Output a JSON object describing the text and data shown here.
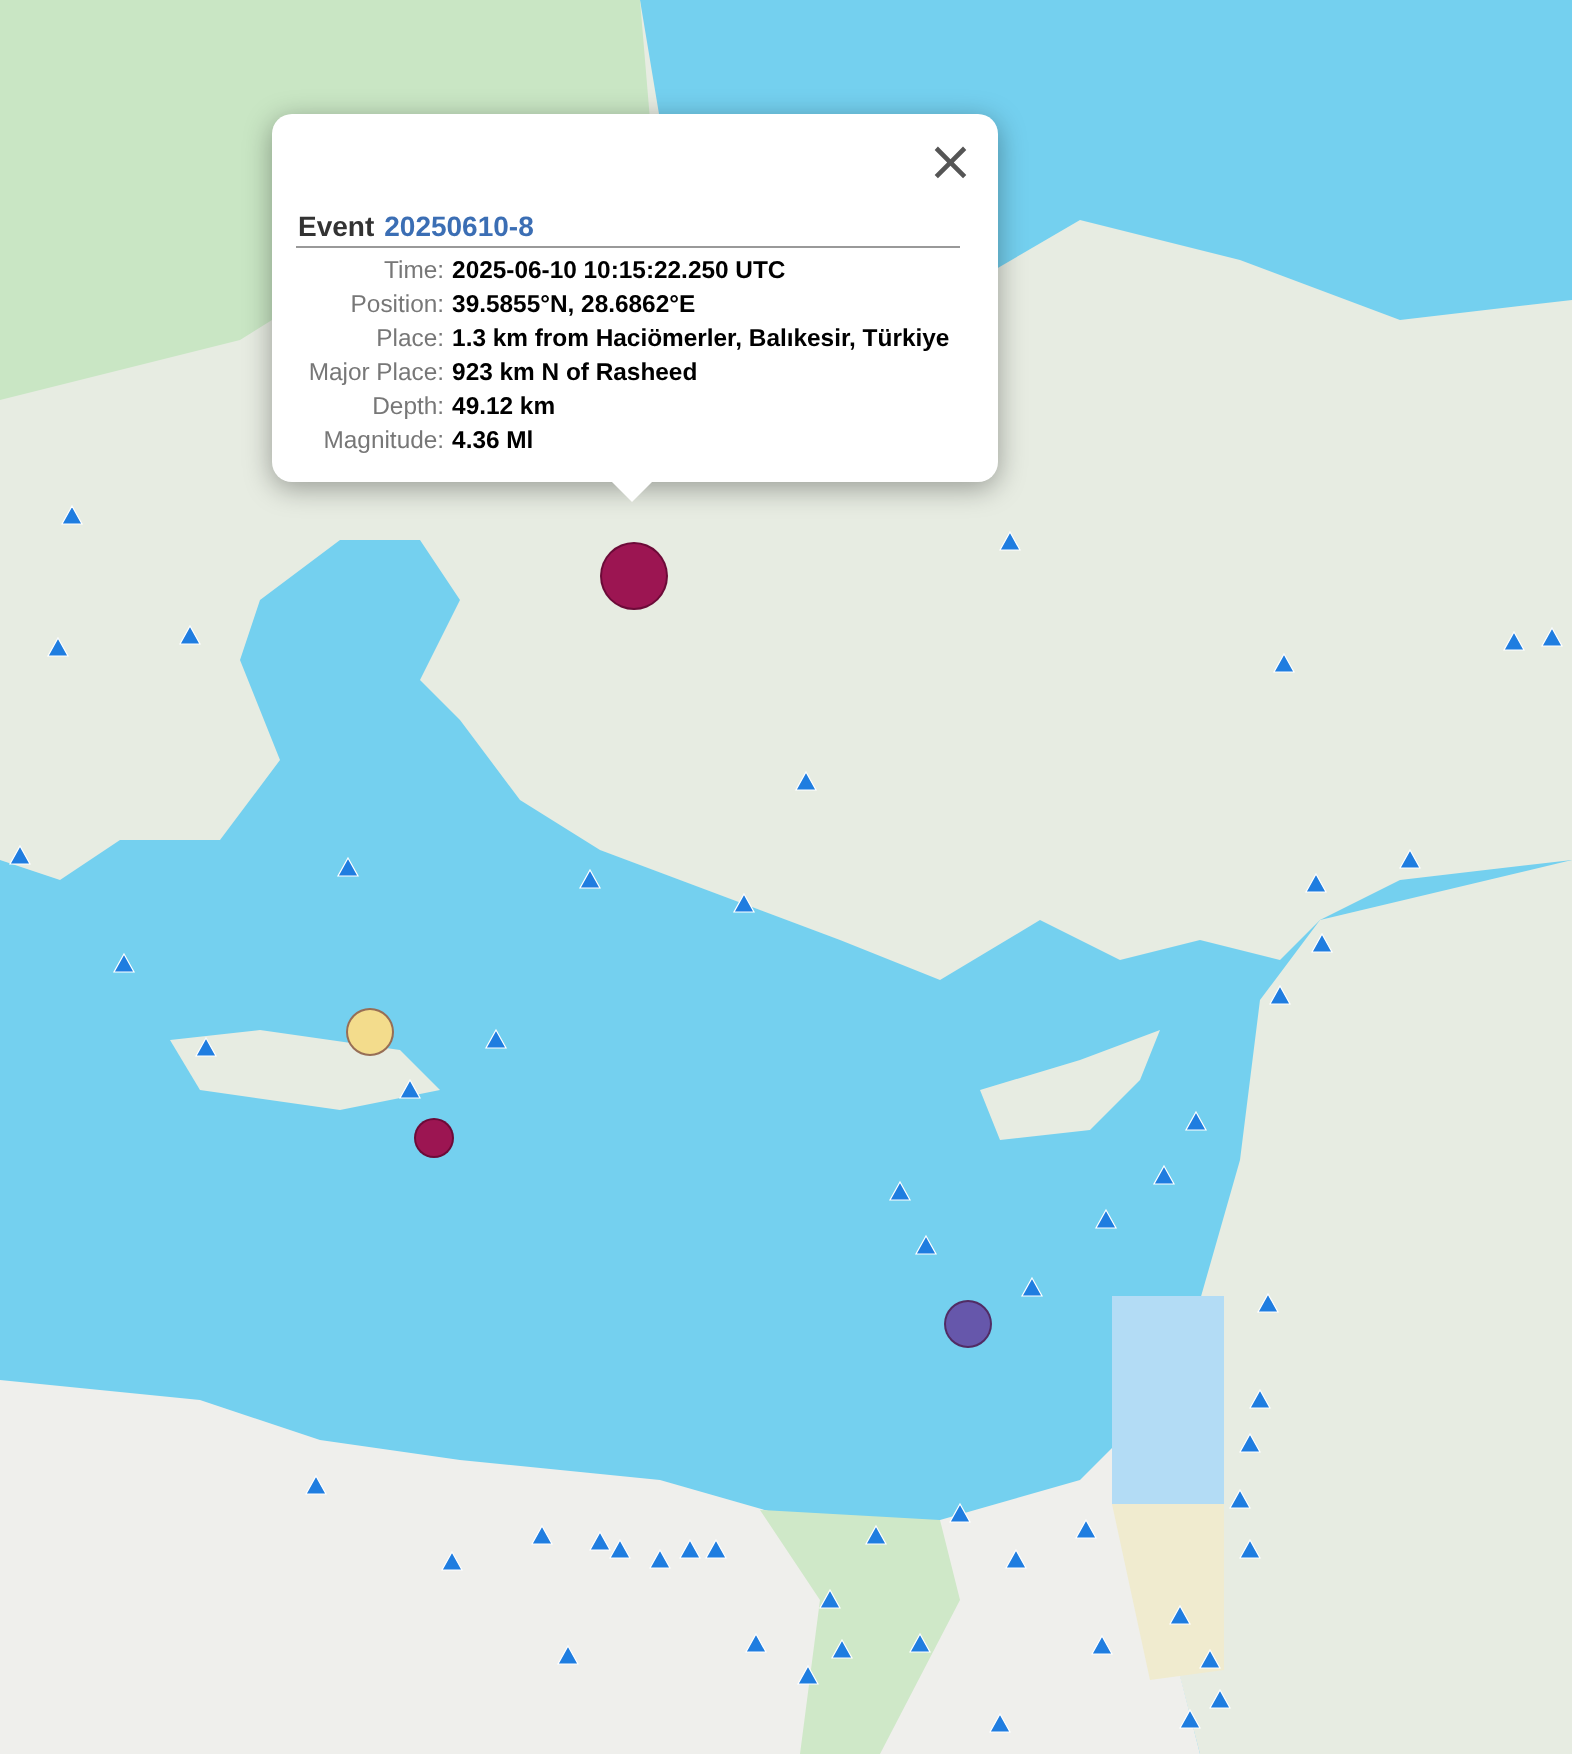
{
  "map": {
    "events": [
      {
        "color": "#9c1552"
      },
      {
        "color": "#f3dc8c"
      },
      {
        "color": "#9c1552"
      },
      {
        "color": "#6657ab"
      }
    ]
  },
  "popup": {
    "title": "Event",
    "event_id": "20250610-8",
    "close": "×",
    "fields": [
      {
        "label": "Time:",
        "value": "2025-06-10 10:15:22.250 UTC"
      },
      {
        "label": "Position:",
        "value": "39.5855°N, 28.6862°E"
      },
      {
        "label": "Place:",
        "value": "1.3 km from Haciömerler, Balıkesir, Türkiye"
      },
      {
        "label": "Major Place:",
        "value": "923 km N of Rasheed"
      },
      {
        "label": "Depth:",
        "value": "49.12 km"
      },
      {
        "label": "Magnitude:",
        "value": "4.36 Ml"
      }
    ]
  }
}
